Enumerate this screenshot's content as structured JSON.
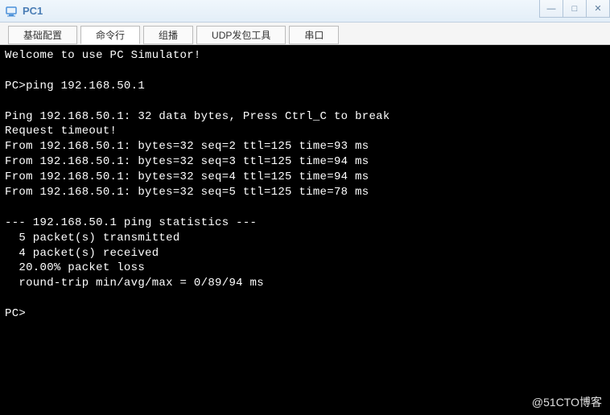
{
  "window": {
    "title": "PC1"
  },
  "tabs": [
    {
      "label": "基础配置",
      "active": false
    },
    {
      "label": "命令行",
      "active": true
    },
    {
      "label": "组播",
      "active": false
    },
    {
      "label": "UDP发包工具",
      "active": false
    },
    {
      "label": "串口",
      "active": false
    }
  ],
  "terminal": {
    "welcome": "Welcome to use PC Simulator!",
    "prompt1": "PC>ping 192.168.50.1",
    "ping_header": "Ping 192.168.50.1: 32 data bytes, Press Ctrl_C to break",
    "timeout": "Request timeout!",
    "replies": [
      "From 192.168.50.1: bytes=32 seq=2 ttl=125 time=93 ms",
      "From 192.168.50.1: bytes=32 seq=3 ttl=125 time=94 ms",
      "From 192.168.50.1: bytes=32 seq=4 ttl=125 time=94 ms",
      "From 192.168.50.1: bytes=32 seq=5 ttl=125 time=78 ms"
    ],
    "stats_header": "--- 192.168.50.1 ping statistics ---",
    "stats_transmitted": "  5 packet(s) transmitted",
    "stats_received": "  4 packet(s) received",
    "stats_loss": "  20.00% packet loss",
    "stats_rtt": "  round-trip min/avg/max = 0/89/94 ms",
    "prompt2": "PC>"
  },
  "watermark": "@51CTO博客"
}
